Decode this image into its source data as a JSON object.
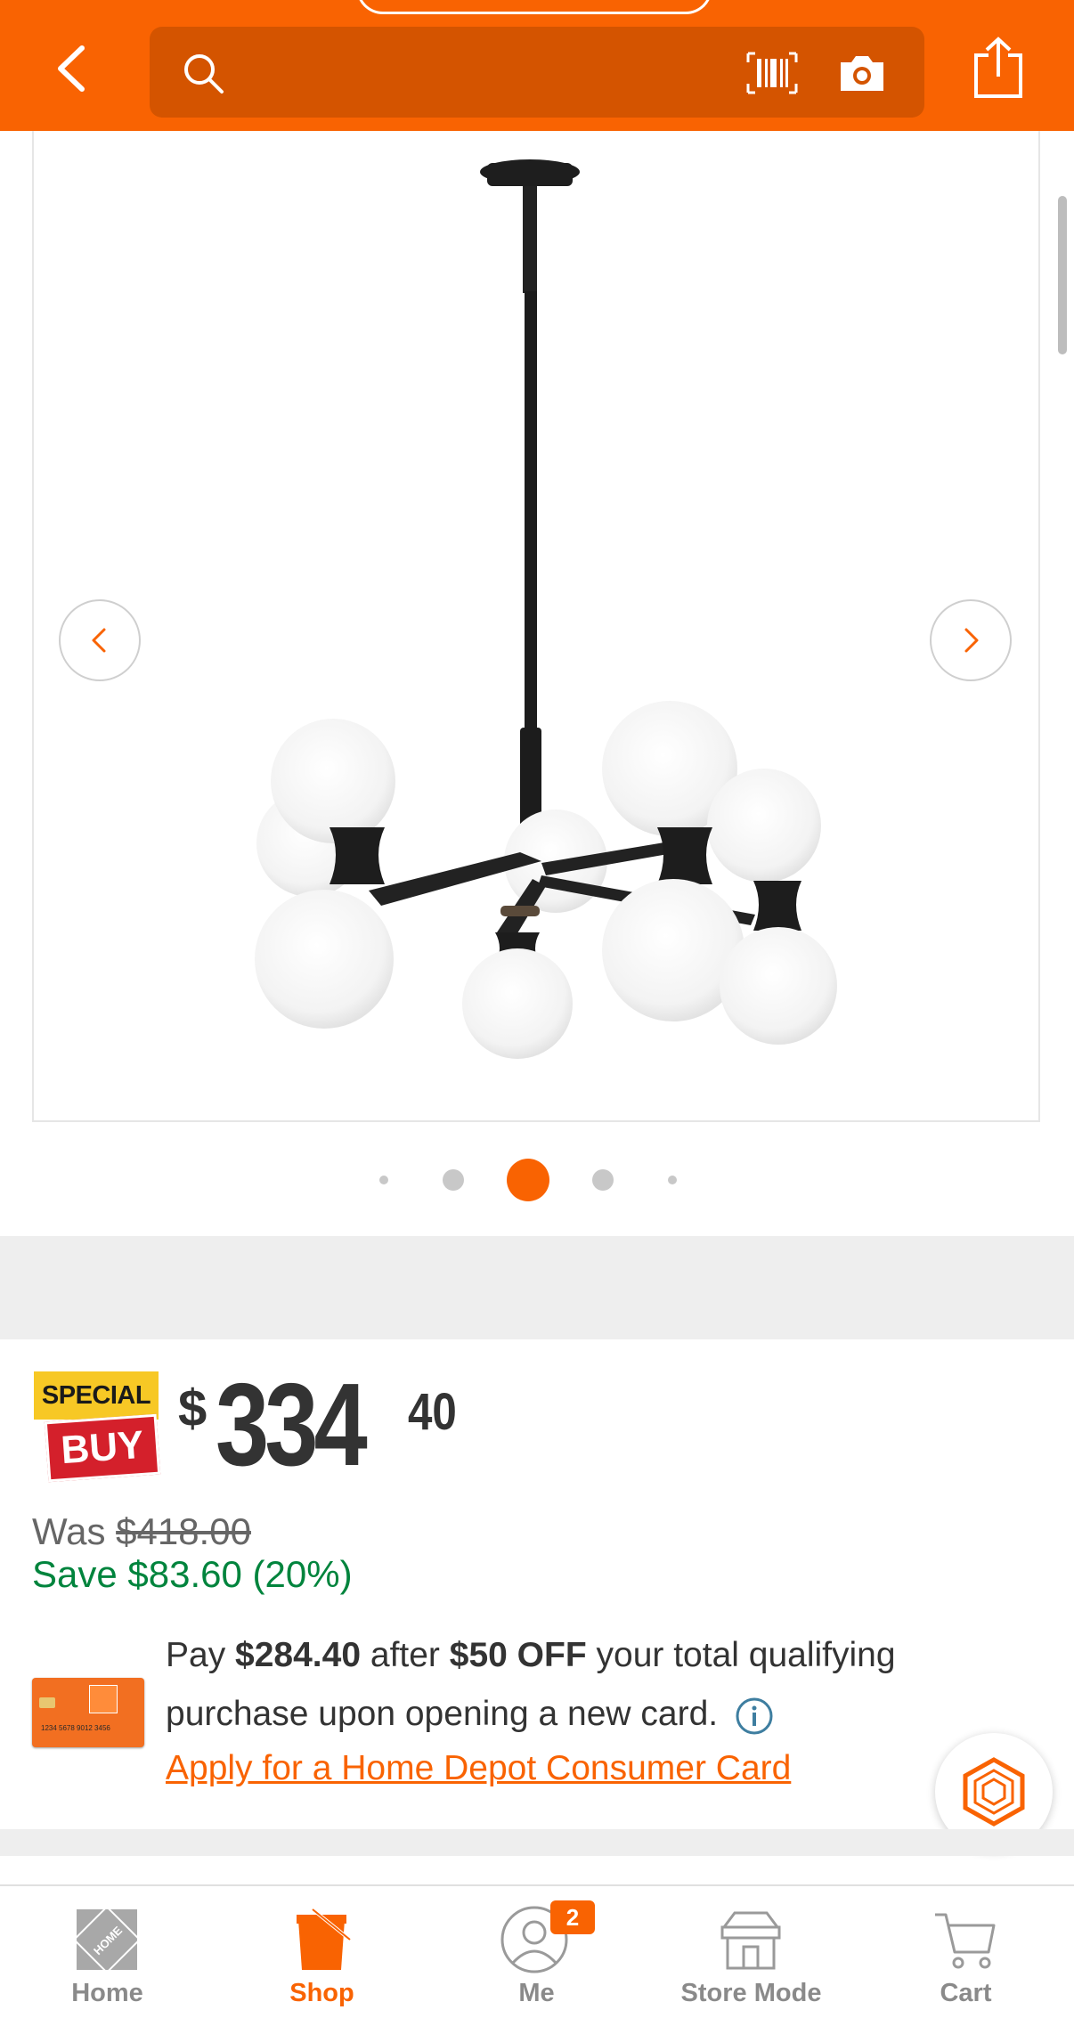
{
  "colors": {
    "brand_orange": "#f96302",
    "save_green": "#00843d",
    "special_yellow": "#f7c825",
    "buy_red": "#d4202b"
  },
  "header": {
    "search_placeholder": ""
  },
  "gallery": {
    "dots_count": 5,
    "active_dot": 3
  },
  "badge": {
    "special": "SPECIAL",
    "buy": "BUY"
  },
  "price": {
    "dollar": "$",
    "whole": "334",
    "cents": "40"
  },
  "was": {
    "label": "Was",
    "old_price": "$418.00"
  },
  "save": {
    "text": "Save $83.60 (20%)"
  },
  "card_img": {
    "number": "1234 5678 9012 3456"
  },
  "offer": {
    "pre": "Pay",
    "pay_amount": "$284.40",
    "mid": "after",
    "off_amount": "$50 OFF",
    "post": "your total qualifying purchase upon opening a new card."
  },
  "apply_link": "Apply for a Home Depot Consumer Card",
  "tabs": [
    {
      "label": "Home"
    },
    {
      "label": "Shop"
    },
    {
      "label": "Me",
      "badge": "2"
    },
    {
      "label": "Store Mode"
    },
    {
      "label": "Cart"
    }
  ]
}
